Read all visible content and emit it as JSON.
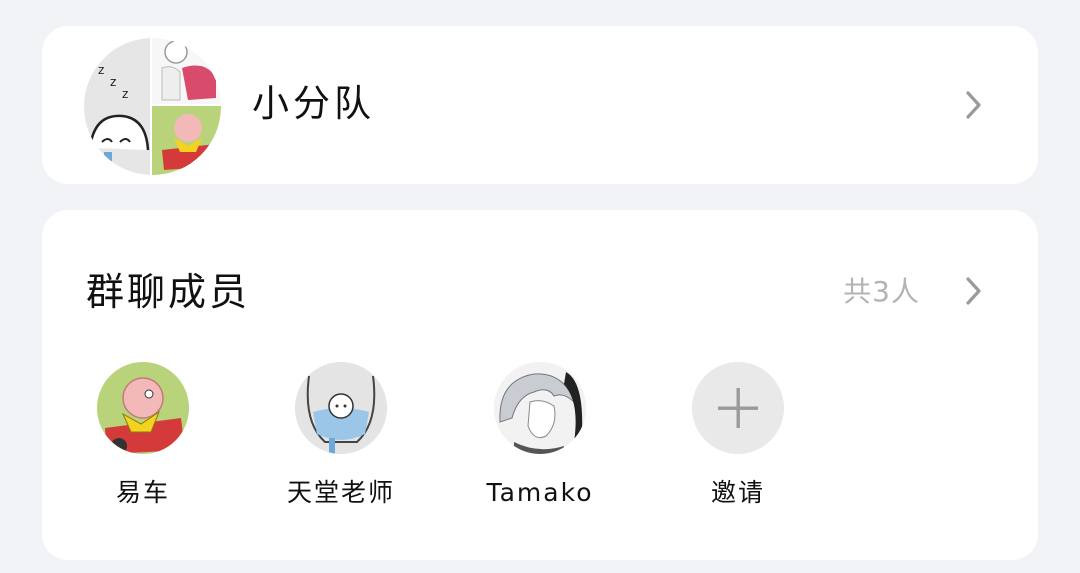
{
  "group": {
    "name": "小分队",
    "avatar_icon": "group-collage-avatar"
  },
  "members_section": {
    "title": "群聊成员",
    "count": "共3人"
  },
  "members": [
    {
      "name": "易车",
      "avatar_icon": "dragon-car-avatar"
    },
    {
      "name": "天堂老师",
      "avatar_icon": "jar-character-avatar"
    },
    {
      "name": "Tamako",
      "avatar_icon": "silver-hair-avatar"
    }
  ],
  "invite": {
    "label": "邀请",
    "icon": "plus-icon"
  },
  "colors": {
    "background": "#f2f3f6",
    "card": "#ffffff",
    "count_text": "#b3b3b3",
    "chevron": "#9a9a9a",
    "invite_bg": "#e9e9ea"
  }
}
